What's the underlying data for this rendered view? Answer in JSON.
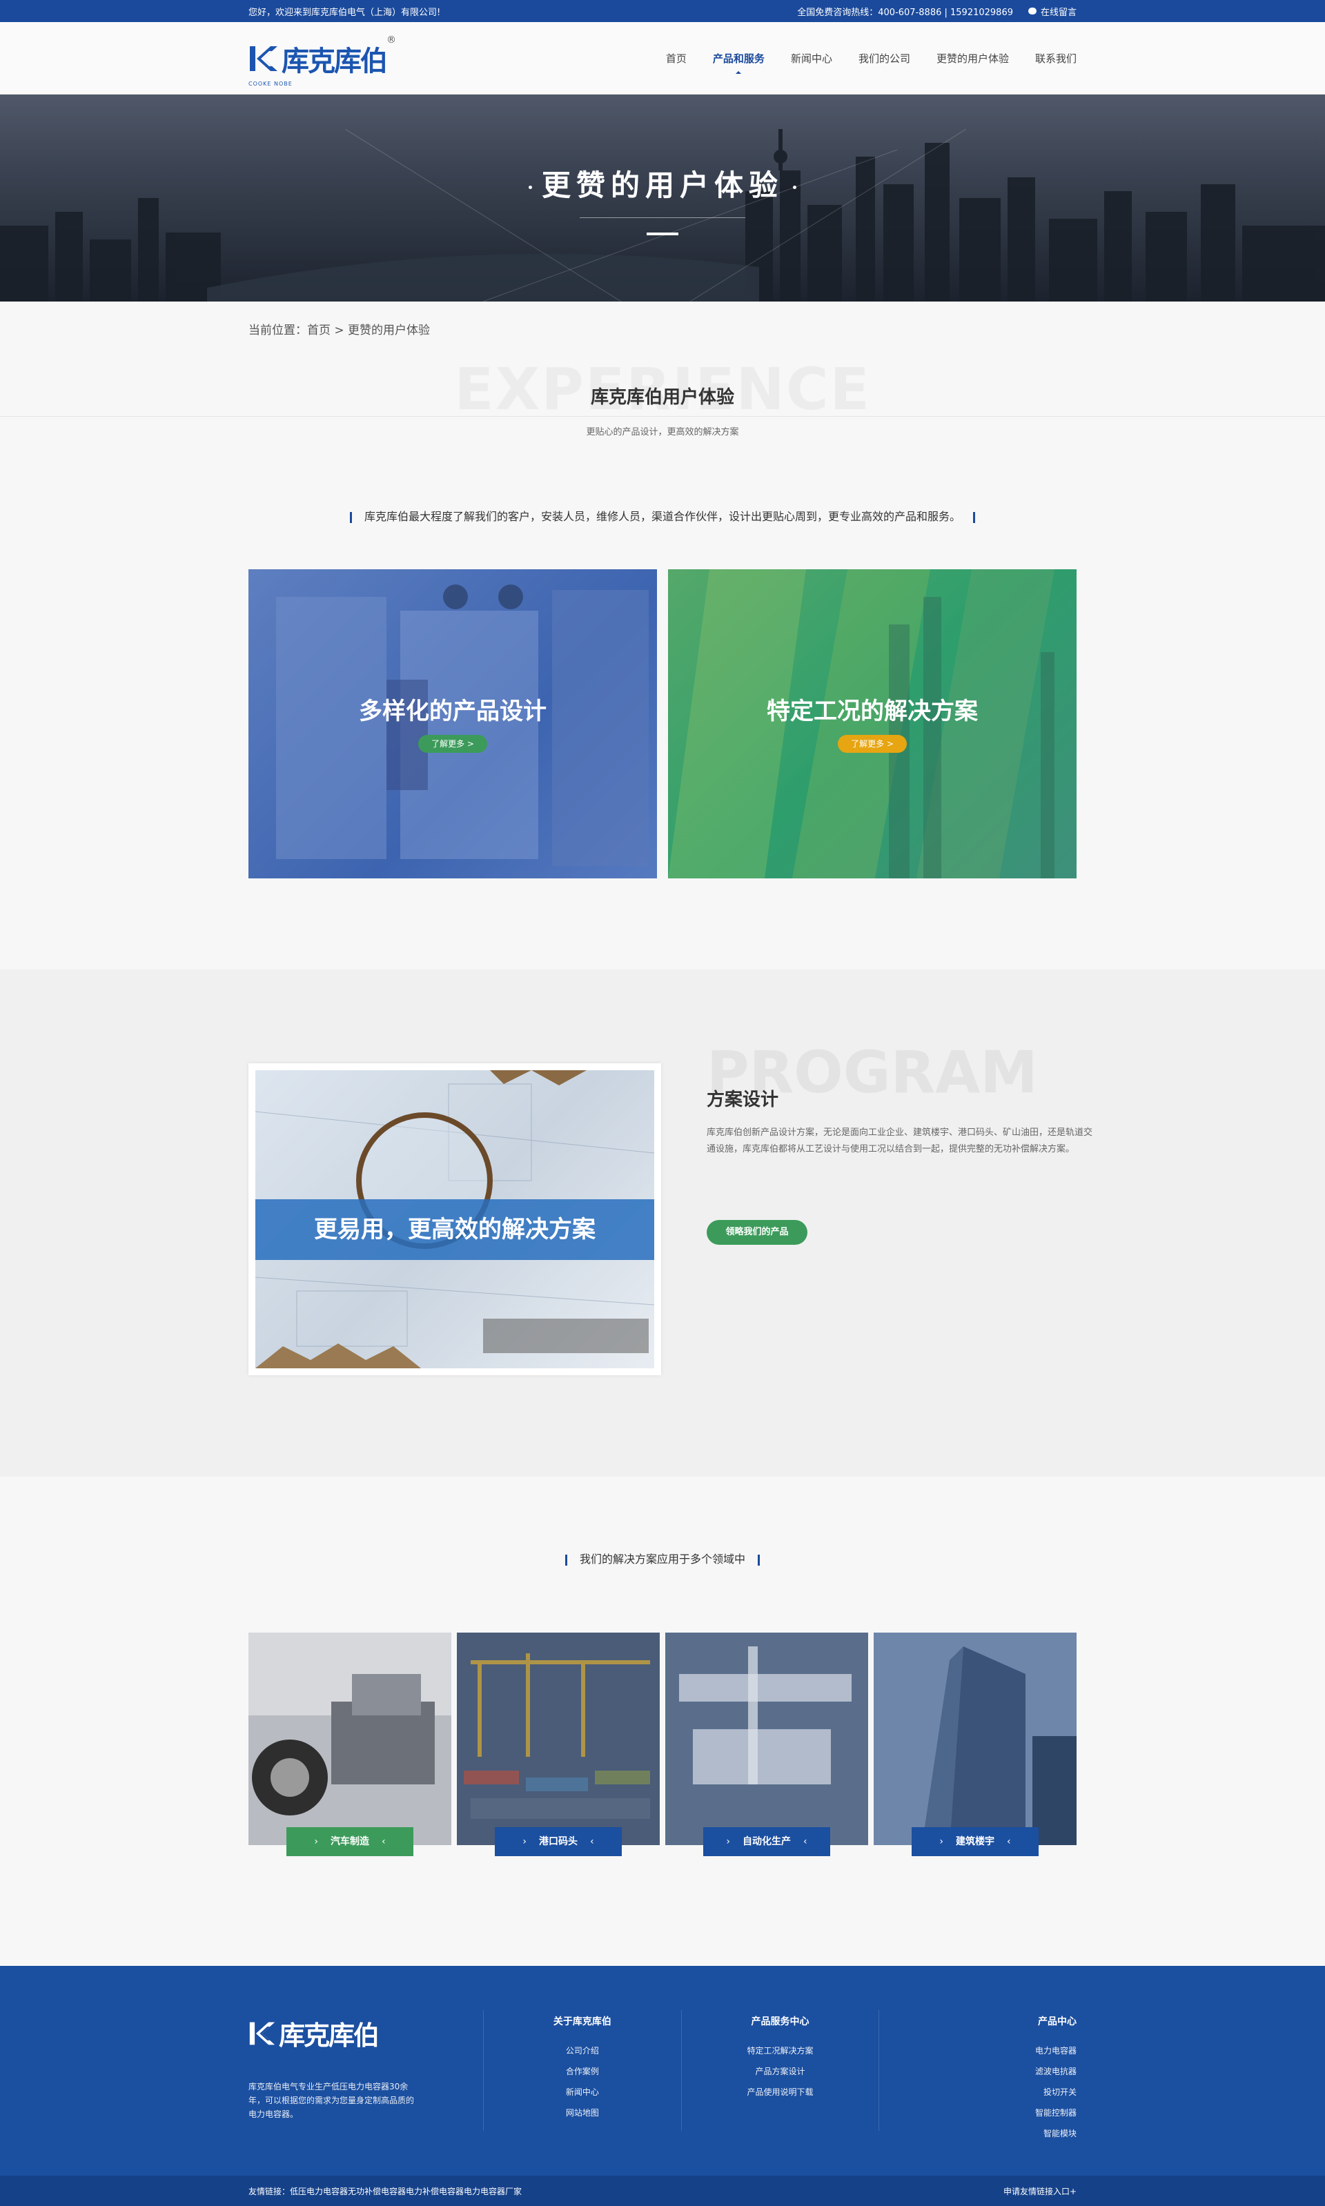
{
  "topbar": {
    "welcome": "您好，欢迎来到库克库伯电气（上海）有限公司!",
    "hotline": "全国免费咨询热线：400-607-8886 | 15921029869",
    "online_msg": "在线留言"
  },
  "header": {
    "logo_text": "库克库伯",
    "logo_sub": "COOKE NOBE",
    "logo_reg": "®",
    "nav": [
      {
        "label": "首页"
      },
      {
        "label": "产品和服务"
      },
      {
        "label": "新闻中心"
      },
      {
        "label": "我们的公司"
      },
      {
        "label": "更赞的用户体验"
      },
      {
        "label": "联系我们"
      }
    ]
  },
  "banner": {
    "title": "更赞的用户体验"
  },
  "breadcrumb": {
    "text": "当前位置：首页 > 更赞的用户体验"
  },
  "experience": {
    "bg_word": "EXPERIENCE",
    "title": "库克库伯用户体验",
    "subtitle": "更贴心的产品设计，更高效的解决方案",
    "lead": "库克库伯最大程度了解我们的客户，安装人员，维修人员，渠道合作伙伴，设计出更贴心周到，更专业高效的产品和服务。",
    "cards": [
      {
        "title": "多样化的产品设计",
        "button": "了解更多 >",
        "btn_color": "#3c9b5a"
      },
      {
        "title": "特定工况的解决方案",
        "button": "了解更多 >",
        "btn_color": "#e6a511"
      }
    ]
  },
  "program": {
    "image_caption": "更易用，更高效的解决方案",
    "bg_word": "PROGRAM",
    "title": "方案设计",
    "description": "库克库伯创新产品设计方案，无论是面向工业企业、建筑楼宇、港口码头、矿山油田，还是轨道交通设施，库克库伯都将从工艺设计与使用工况以结合到一起，提供完整的无功补偿解决方案。",
    "button": "领略我们的产品"
  },
  "domains": {
    "lead": "我们的解决方案应用于多个领域中",
    "tiles": [
      {
        "label": "汽车制造",
        "color": "#3c9b5a"
      },
      {
        "label": "港口码头",
        "color": "#1b4fa0"
      },
      {
        "label": "自动化生产",
        "color": "#1b4fa0"
      },
      {
        "label": "建筑楼宇",
        "color": "#1b4fa0"
      }
    ]
  },
  "footer": {
    "logo_text": "库克库伯",
    "intro": "库克库伯电气专业生产低压电力电容器30余年，可以根据您的需求为您量身定制高品质的电力电容器。",
    "cols": [
      {
        "title": "关于库克库伯",
        "items": [
          "公司介绍",
          "合作案例",
          "新闻中心",
          "网站地图"
        ]
      },
      {
        "title": "产品服务中心",
        "items": [
          "特定工况解决方案",
          "产品方案设计",
          "产品使用说明下载"
        ]
      },
      {
        "title": "产品中心",
        "items": [
          "电力电容器",
          "滤波电抗器",
          "投切开关",
          "智能控制器",
          "智能模块"
        ]
      }
    ],
    "links": "友情链接：低压电力电容器无功补偿电容器电力补偿电容器电力电容器厂家",
    "apply_link": "申请友情链接入口+"
  },
  "colors": {
    "primary": "#1b4a9c",
    "green": "#3c9b5a",
    "orange": "#e6a511"
  }
}
